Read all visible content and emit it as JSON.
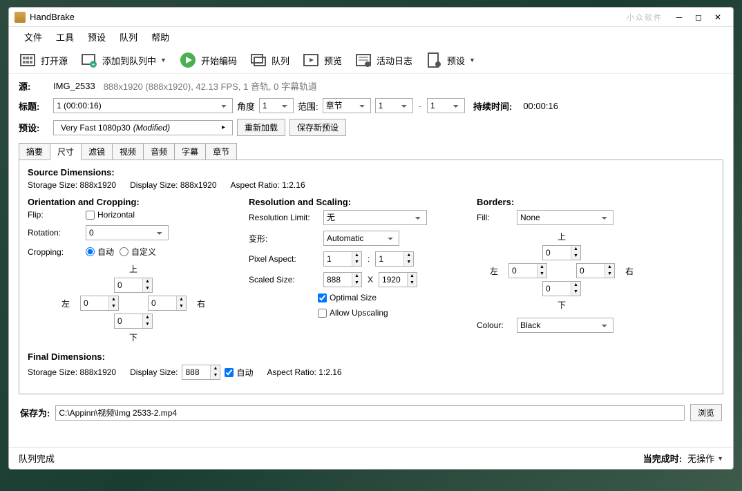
{
  "title": "HandBrake",
  "watermark": "小众软件",
  "menu": {
    "file": "文件",
    "tools": "工具",
    "presets": "预设",
    "queue": "队列",
    "help": "帮助"
  },
  "toolbar": {
    "open": "打开源",
    "add_queue": "添加到队列中",
    "start": "开始编码",
    "queue": "队列",
    "preview": "预览",
    "activity": "活动日志",
    "presets": "预设"
  },
  "source": {
    "label": "源:",
    "name": "IMG_2533",
    "info": "888x1920 (888x1920), 42.13 FPS, 1 音轨, 0 字幕轨道"
  },
  "title_row": {
    "label": "标题:",
    "title_value": "1  (00:00:16)",
    "angle_label": "角度",
    "angle_value": "1",
    "range_label": "范围:",
    "range_type": "章节",
    "range_start": "1",
    "range_sep": "-",
    "range_end": "1",
    "duration_label": "持续时间:",
    "duration_value": "00:00:16"
  },
  "preset_row": {
    "label": "预设:",
    "preset_name": "Very Fast 1080p30",
    "modified": "(Modified)",
    "reload": "重新加载",
    "save_new": "保存新预设"
  },
  "tabs": {
    "summary": "摘要",
    "dimensions": "尺寸",
    "filters": "滤镜",
    "video": "视频",
    "audio": "音频",
    "subtitles": "字幕",
    "chapters": "章节"
  },
  "dim": {
    "source_title": "Source Dimensions:",
    "storage_size_label": "Storage Size:",
    "storage_size": "888x1920",
    "display_size_label": "Display Size:",
    "display_size": "888x1920",
    "aspect_label": "Aspect Ratio:",
    "aspect": "1:2.16",
    "orient_title": "Orientation and Cropping:",
    "flip_label": "Flip:",
    "flip_horizontal": "Horizontal",
    "rotation_label": "Rotation:",
    "rotation_value": "0",
    "cropping_label": "Cropping:",
    "crop_auto": "自动",
    "crop_custom": "自定义",
    "top": "上",
    "left": "左",
    "right": "右",
    "bottom": "下",
    "crop_top": "0",
    "crop_left": "0",
    "crop_right": "0",
    "crop_bottom": "0",
    "res_title": "Resolution and Scaling:",
    "res_limit_label": "Resolution Limit:",
    "res_limit": "无",
    "anamorphic_label": "变形:",
    "anamorphic": "Automatic",
    "pixel_aspect_label": "Pixel Aspect:",
    "par_x": "1",
    "par_colon": ":",
    "par_y": "1",
    "scaled_label": "Scaled Size:",
    "scaled_w": "888",
    "scaled_x": "X",
    "scaled_h": "1920",
    "optimal_size": "Optimal Size",
    "allow_upscaling": "Allow Upscaling",
    "borders_title": "Borders:",
    "fill_label": "Fill:",
    "fill_value": "None",
    "border_top": "0",
    "border_left": "0",
    "border_right": "0",
    "border_bottom": "0",
    "colour_label": "Colour:",
    "colour_value": "Black",
    "final_title": "Final Dimensions:",
    "final_storage": "888x1920",
    "final_display_val": "888",
    "final_auto": "自动",
    "final_aspect": "1:2.16"
  },
  "save": {
    "label": "保存为:",
    "path": "C:\\Appinn\\视频\\Img 2533-2.mp4",
    "browse": "浏览"
  },
  "status": {
    "queue": "队列完成",
    "when_done_label": "当完成时:",
    "when_done_value": "无操作"
  }
}
